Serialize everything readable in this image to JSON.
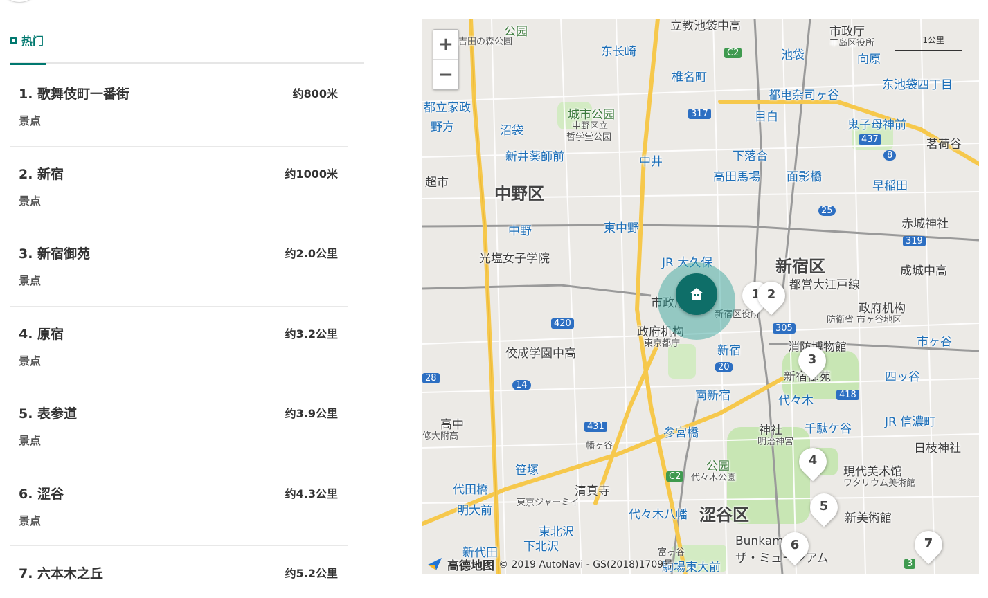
{
  "tabs": {
    "hot_label": "热门"
  },
  "poi_list": [
    {
      "title": "1. 歌舞伎町一番街",
      "distance": "约800米",
      "category": "景点"
    },
    {
      "title": "2. 新宿",
      "distance": "约1000米",
      "category": "景点"
    },
    {
      "title": "3. 新宿御苑",
      "distance": "约2.0公里",
      "category": "景点"
    },
    {
      "title": "4. 原宿",
      "distance": "约3.2公里",
      "category": "景点"
    },
    {
      "title": "5. 表参道",
      "distance": "约3.9公里",
      "category": "景点"
    },
    {
      "title": "6. 涩谷",
      "distance": "约4.3公里",
      "category": "景点"
    },
    {
      "title": "7. 六本木之丘",
      "distance": "约5.2公里",
      "category": ""
    }
  ],
  "map": {
    "zoom_in": "+",
    "zoom_out": "−",
    "scale_label": "1公里",
    "ward_labels": [
      "中野区",
      "新宿区",
      "涩谷区"
    ],
    "place_labels": [
      "立教池袋中高",
      "市政厅",
      "丰岛区役所",
      "东长崎",
      "椎名町",
      "池袋",
      "向原",
      "都电杂司ヶ谷",
      "东池袋四丁目",
      "都立家政",
      "野方",
      "沼袋",
      "城市公园",
      "中野区立",
      "哲学堂公园",
      "目白",
      "鬼子母神前",
      "茗荷谷",
      "新井薬師前",
      "中井",
      "下落合",
      "高田馬場",
      "面影橋",
      "早稲田",
      "超市",
      "中野",
      "東中野",
      "赤城神社",
      "光塩女子学院",
      "JR 大久保",
      "成城中高",
      "市政厅",
      "新宿区役所",
      "政府机构",
      "防衛省 市ヶ谷地区",
      "政府机构",
      "東京都庁",
      "新宿",
      "消防博物館",
      "市ヶ谷",
      "佼成学園中高",
      "新宿御苑",
      "四ッ谷",
      "南新宿",
      "代々木",
      "高中",
      "修大附高",
      "参宮橋",
      "神社",
      "明治神宮",
      "千駄ケ谷",
      "JR 信濃町",
      "日枝神社",
      "笹塚",
      "代田橋",
      "明大前",
      "清真寺",
      "東京ジャーミイ",
      "公园",
      "代々木公園",
      "現代美术馆",
      "ワタリウム美術館",
      "代々木八幡",
      "新美術館",
      "東北沢",
      "下北沢",
      "新代田",
      "富ヶ谷",
      "Bunkamura",
      "ザ・ミュージアム",
      "駒場東大前",
      "都営大江戸線",
      "公园",
      "吉田の森公園",
      "幡ヶ谷"
    ],
    "route_badges": [
      "C2",
      "317",
      "437",
      "8",
      "25",
      "319",
      "305",
      "420",
      "20",
      "418",
      "14",
      "431",
      "28",
      "C2",
      "3"
    ],
    "markers": [
      "1",
      "2",
      "3",
      "4",
      "5",
      "6",
      "7"
    ],
    "logo_text": "高德地图",
    "copyright": "© 2019 AutoNavi - GS(2018)1709号"
  },
  "colors": {
    "accent": "#00786f",
    "home_marker": "#0e6e68",
    "park": "#c8e6b4",
    "major_road": "#f6c84c",
    "rail": "#9a9a9a"
  }
}
